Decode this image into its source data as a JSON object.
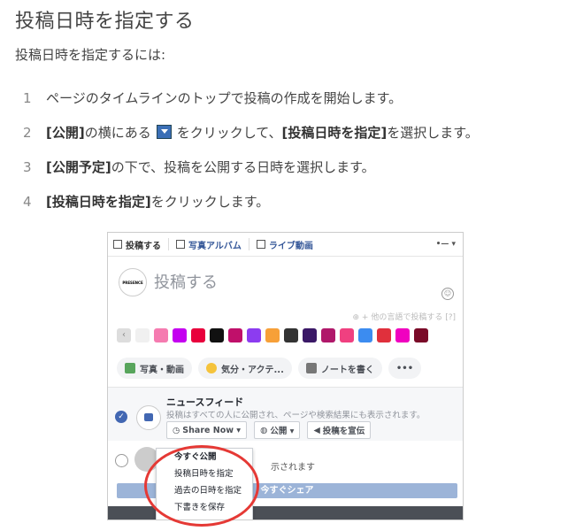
{
  "page": {
    "title": "投稿日時を指定する",
    "intro": "投稿日時を指定するには:",
    "steps": [
      {
        "num": "1",
        "pre": "ページのタイムラインのトップで投稿の作成を開始します。",
        "bold": "",
        "post": ""
      },
      {
        "num": "2",
        "bold": "[公開]",
        "mid": "の横にある",
        "after_icon": "をクリックして、",
        "bold2": "[投稿日時を指定]",
        "post": "を選択します。"
      },
      {
        "num": "3",
        "bold": "[公開予定]",
        "post": "の下で、投稿を公開する日時を選択します。"
      },
      {
        "num": "4",
        "bold": "[投稿日時を指定]",
        "post": "をクリックします。"
      }
    ]
  },
  "screenshot": {
    "tabs": [
      {
        "label": "投稿する",
        "icon": "pencil-icon"
      },
      {
        "label": "写真アルバム",
        "icon": "album-icon"
      },
      {
        "label": "ライブ動画",
        "icon": "video-camera-icon"
      }
    ],
    "tabs_right": "•— ▾",
    "logo_text": "PRESENCE",
    "composer_placeholder": "投稿する",
    "lang_link": "⊕ + 他の言語で投稿する  [?]",
    "swatch_colors": [
      "#f0f0f0",
      "#f57bb0",
      "#c400f0",
      "#e8003c",
      "#111111",
      "#c0106a",
      "#8c3cf0",
      "#f7a038",
      "#333333",
      "#3a1866",
      "#b0186a",
      "#f04080",
      "#3c8cf0",
      "#e0303c",
      "#f000c0",
      "#7a0a28"
    ],
    "actions": [
      {
        "label": "写真・動画",
        "icon": "photo-icon",
        "color": "#58a55c"
      },
      {
        "label": "気分・アクテ...",
        "icon": "smile-icon",
        "color": "#f5c33b"
      },
      {
        "label": "ノートを書く",
        "icon": "note-icon",
        "color": "#777777"
      },
      {
        "label": "•••",
        "icon": "more-icon",
        "color": "#999999"
      }
    ],
    "newsfeed": {
      "title": "ニュースフィード",
      "desc": "投稿はすべての人に公開され、ページや検索結果にも表示されます。",
      "share_now": "Share Now ▾",
      "public": "公開 ▾",
      "promote": "投稿を宣伝"
    },
    "story_text": "示されます",
    "dropdown": {
      "items": [
        "今すぐ公開",
        "投稿日時を指定",
        "過去の日時を指定",
        "下書きを保存"
      ]
    },
    "share_button": "今すぐシェア"
  }
}
